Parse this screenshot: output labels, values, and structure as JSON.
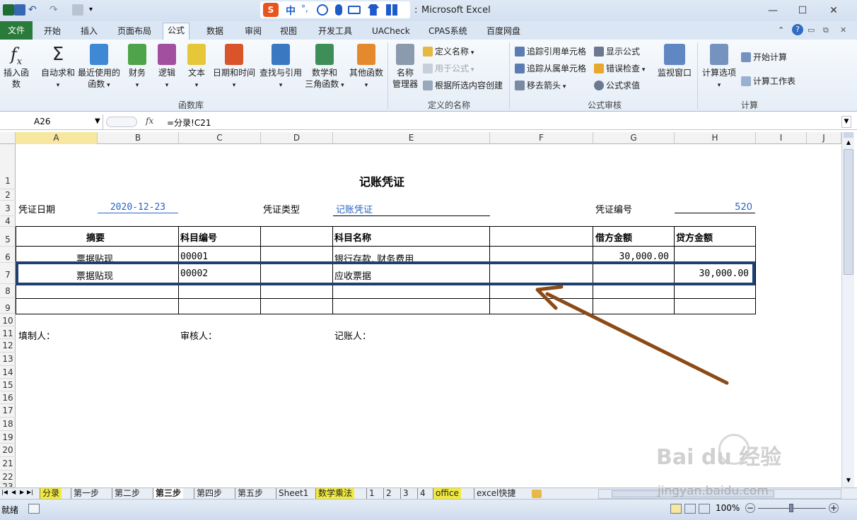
{
  "window": {
    "title": "Microsoft Excel",
    "title_fragment": ":"
  },
  "quick_access": {
    "ime_label": "中",
    "ime_dot": "°,"
  },
  "ribbon_tabs": [
    "文件",
    "开始",
    "插入",
    "页面布局",
    "公式",
    "数据",
    "审阅",
    "视图",
    "开发工具",
    "UACheck",
    "CPAS系统",
    "百度网盘"
  ],
  "ribbon": {
    "function_library": {
      "insert_function": "插入函数",
      "autosum": "自动求和",
      "recently_used_1": "最近使用的",
      "recently_used_2": "函数",
      "financial": "财务",
      "logical": "逻辑",
      "text": "文本",
      "datetime": "日期和时间",
      "lookup": "查找与引用",
      "math_1": "数学和",
      "math_2": "三角函数",
      "more": "其他函数",
      "group_label": "函数库"
    },
    "defined_names": {
      "name_manager_1": "名称",
      "name_manager_2": "管理器",
      "define_name": "定义名称",
      "use_in_formula": "用于公式",
      "create_from_selection": "根据所选内容创建",
      "group_label": "定义的名称"
    },
    "formula_auditing": {
      "trace_precedents": "追踪引用单元格",
      "trace_dependents": "追踪从属单元格",
      "remove_arrows": "移去箭头",
      "show_formulas": "显示公式",
      "error_checking": "错误检查",
      "evaluate_formula": "公式求值",
      "watch_window": "监视窗口",
      "group_label": "公式审核"
    },
    "calculation": {
      "calc_options": "计算选项",
      "calc_now": "开始计算",
      "calc_sheet": "计算工作表",
      "group_label": "计算"
    }
  },
  "formula_bar": {
    "name_box": "A26",
    "fx": "fx",
    "formula": "=分录!C21"
  },
  "columns": [
    "A",
    "B",
    "C",
    "D",
    "E",
    "F",
    "G",
    "H",
    "I",
    "J"
  ],
  "rows": [
    "1",
    "2",
    "3",
    "4",
    "5",
    "6",
    "7",
    "8",
    "9",
    "10",
    "11",
    "12",
    "13",
    "14",
    "15",
    "16",
    "17",
    "18",
    "19",
    "20",
    "21",
    "22",
    "23"
  ],
  "sheet": {
    "title": "记账凭证",
    "date_label": "凭证日期",
    "date_value": "2020-12-23",
    "type_label": "凭证类型",
    "type_value": "记账凭证",
    "number_label": "凭证编号",
    "number_value": "520",
    "headers": {
      "summary": "摘要",
      "account_code": "科目编号",
      "account_name": "科目名称",
      "debit": "借方金额",
      "credit": "贷方金额"
    },
    "entries": [
      {
        "summary": "票据贴现",
        "code": "00001",
        "name": "银行存款, 财务费用",
        "debit": "30,000.00",
        "credit": ""
      },
      {
        "summary": "票据贴现",
        "code": "00002",
        "name": "应收票据",
        "debit": "",
        "credit": "30,000.00"
      }
    ],
    "footer": {
      "preparer": "填制人：",
      "reviewer": "审核人：",
      "bookkeeper": "记账人："
    }
  },
  "sheet_tabs": [
    {
      "label": "分录",
      "style": "yellow"
    },
    {
      "label": "第一步",
      "style": "normal"
    },
    {
      "label": "第二步",
      "style": "normal"
    },
    {
      "label": "第三步",
      "style": "active"
    },
    {
      "label": "第四步",
      "style": "normal"
    },
    {
      "label": "第五步",
      "style": "normal"
    },
    {
      "label": "Sheet1",
      "style": "normal"
    },
    {
      "label": "数学乘法",
      "style": "yellow"
    },
    {
      "label": "1",
      "style": "normal"
    },
    {
      "label": "2",
      "style": "normal"
    },
    {
      "label": "3",
      "style": "normal"
    },
    {
      "label": "4",
      "style": "normal"
    },
    {
      "label": "office",
      "style": "yellow"
    },
    {
      "label": "excel快捷",
      "style": "normal"
    }
  ],
  "status": {
    "ready": "就绪",
    "zoom": "100%"
  },
  "watermark": {
    "brand": "Bai du 经验",
    "url": "jingyan.baidu.com"
  },
  "colors": {
    "highlight_box": "#1f3f6e",
    "arrow": "#8b4a16",
    "file_tab": "#2a7a3a",
    "link_blue": "#2a63c3"
  }
}
